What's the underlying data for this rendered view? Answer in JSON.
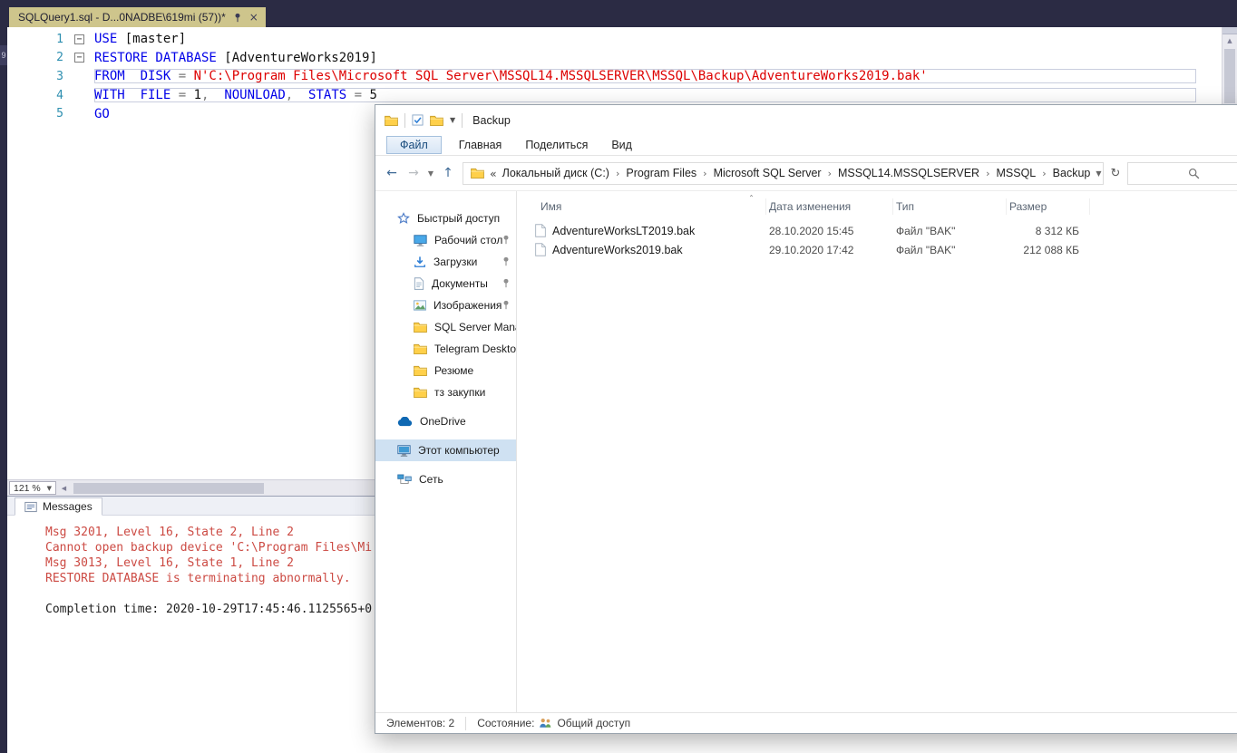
{
  "ssms": {
    "tab_title": "SQLQuery1.sql - D...0NADBE\\619mi (57))*",
    "autohide_label": "9",
    "editor_zoom": "121 %",
    "editor": {
      "lines": [
        {
          "num": "1",
          "fold": true,
          "boxed": false,
          "tokens": [
            {
              "t": "USE ",
              "c": "kw"
            },
            {
              "t": "[master]",
              "c": "id"
            }
          ]
        },
        {
          "num": "2",
          "fold": true,
          "boxed": false,
          "tokens": [
            {
              "t": "RESTORE DATABASE ",
              "c": "kw"
            },
            {
              "t": "[AdventureWorks2019]",
              "c": "id"
            }
          ]
        },
        {
          "num": "3",
          "fold": false,
          "boxed": true,
          "tokens": [
            {
              "t": "FROM  DISK ",
              "c": "kw"
            },
            {
              "t": "= ",
              "c": "op"
            },
            {
              "t": "N'C:\\Program Files\\Microsoft SQL Server\\MSSQL14.MSSQLSERVER\\MSSQL\\Backup\\AdventureWorks2019.bak'",
              "c": "str"
            }
          ]
        },
        {
          "num": "4",
          "fold": false,
          "boxed": true,
          "tokens": [
            {
              "t": "WITH  FILE ",
              "c": "kw"
            },
            {
              "t": "= ",
              "c": "op"
            },
            {
              "t": "1",
              "c": "num"
            },
            {
              "t": ",  ",
              "c": "op"
            },
            {
              "t": "NOUNLOAD",
              "c": "kw"
            },
            {
              "t": ",  ",
              "c": "op"
            },
            {
              "t": "STATS ",
              "c": "kw"
            },
            {
              "t": "= ",
              "c": "op"
            },
            {
              "t": "5",
              "c": "num"
            }
          ]
        },
        {
          "num": "5",
          "fold": false,
          "boxed": false,
          "tokens": [
            {
              "t": "GO",
              "c": "kw"
            }
          ]
        }
      ]
    },
    "messages": {
      "tab_label": "Messages",
      "lines": [
        {
          "text": "Msg 3201, Level 16, State 2, Line 2",
          "error": true
        },
        {
          "text": "Cannot open backup device 'C:\\Program Files\\Mi",
          "error": true
        },
        {
          "text": "Msg 3013, Level 16, State 1, Line 2",
          "error": true
        },
        {
          "text": "RESTORE DATABASE is terminating abnormally.",
          "error": true
        },
        {
          "text": "",
          "error": false
        },
        {
          "text": "Completion time: 2020-10-29T17:45:46.1125565+0",
          "error": false
        }
      ]
    }
  },
  "explorer": {
    "window_title": "Backup",
    "ribbon_tabs": [
      "Файл",
      "Главная",
      "Поделиться",
      "Вид"
    ],
    "breadcrumb": {
      "overflow": "«",
      "segments": [
        "Локальный диск (C:)",
        "Program Files",
        "Microsoft SQL Server",
        "MSSQL14.MSSQLSERVER",
        "MSSQL",
        "Backup"
      ]
    },
    "nav_items": [
      {
        "label": "Быстрый доступ",
        "icon": "star",
        "level": 0,
        "pinned": false,
        "selected": false,
        "gap": false
      },
      {
        "label": "Рабочий стол",
        "icon": "desktop",
        "level": 1,
        "pinned": true,
        "selected": false,
        "gap": false
      },
      {
        "label": "Загрузки",
        "icon": "downloads",
        "level": 1,
        "pinned": true,
        "selected": false,
        "gap": false
      },
      {
        "label": "Документы",
        "icon": "document",
        "level": 1,
        "pinned": true,
        "selected": false,
        "gap": false
      },
      {
        "label": "Изображения",
        "icon": "picture",
        "level": 1,
        "pinned": true,
        "selected": false,
        "gap": false
      },
      {
        "label": "SQL Server Manage",
        "icon": "folder",
        "level": 1,
        "pinned": false,
        "selected": false,
        "gap": false
      },
      {
        "label": "Telegram Desktop",
        "icon": "folder",
        "level": 1,
        "pinned": false,
        "selected": false,
        "gap": false
      },
      {
        "label": "Резюме",
        "icon": "folder",
        "level": 1,
        "pinned": false,
        "selected": false,
        "gap": false
      },
      {
        "label": "тз закупки",
        "icon": "folder",
        "level": 1,
        "pinned": false,
        "selected": false,
        "gap": false
      },
      {
        "label": "OneDrive",
        "icon": "cloud",
        "level": 0,
        "pinned": false,
        "selected": false,
        "gap": true
      },
      {
        "label": "Этот компьютер",
        "icon": "computer",
        "level": 0,
        "pinned": false,
        "selected": true,
        "gap": true
      },
      {
        "label": "Сеть",
        "icon": "network",
        "level": 0,
        "pinned": false,
        "selected": false,
        "gap": true
      }
    ],
    "columns": [
      "Имя",
      "Дата изменения",
      "Тип",
      "Размер"
    ],
    "files": [
      {
        "name": "AdventureWorksLT2019.bak",
        "date": "28.10.2020 15:45",
        "type": "Файл \"BAK\"",
        "size": "8 312 КБ"
      },
      {
        "name": "AdventureWorks2019.bak",
        "date": "29.10.2020 17:42",
        "type": "Файл \"BAK\"",
        "size": "212 088 КБ"
      }
    ],
    "status": {
      "items": "Элементов: 2",
      "state_label": "Состояние:",
      "state_value": "Общий доступ"
    }
  }
}
